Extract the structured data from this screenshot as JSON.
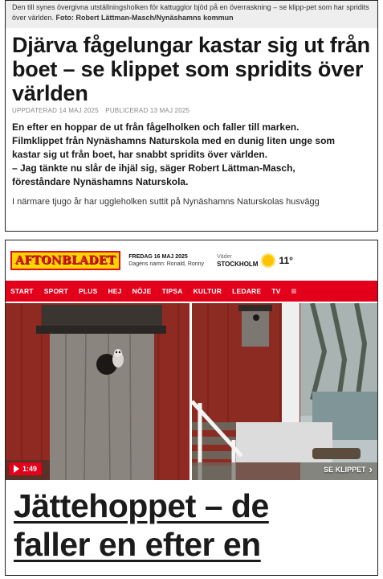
{
  "article_top": {
    "caption": "Den till synes övergivna utställningsholken för kattugglor bjöd på en överraskning – se klipp-pet som har spridits över världen.",
    "caption_credit": "Foto: Robert Lättman-Masch/Nynäshamns kommun",
    "headline": "Djärva fågelungar kastar sig ut från boet – se klippet som spridits över världen",
    "updated": "UPPDATERAD 14 MAJ 2025",
    "published": "PUBLICERAD 13 MAJ 2025",
    "lead_lines": [
      "En efter en hoppar de ut från fågelholken och faller till marken.",
      "Filmklippet från Nynäshamns Naturskola med en dunig liten unge som",
      "kastar sig ut från boet, har snabbt spridits över världen.",
      "– Jag tänkte nu slår de ihjäl sig, säger Robert Lättman-Masch,",
      "föreståndare Nynäshamns Naturskola."
    ],
    "body_partial": "I närmare tjugo år har uggleholken suttit på Nynäshamns Naturskolas husvägg"
  },
  "aftonbladet": {
    "logo": "AFTONBLADET",
    "date_line1": "FREDAG 16 MAJ 2025",
    "date_line2": "Dagens namn: Ronald, Ronny",
    "weather_label": "Väder",
    "weather_city": "STOCKHOLM",
    "weather_temp": "11°",
    "weather_icon": "sun-icon",
    "nav": [
      "START",
      "SPORT",
      "PLUS",
      "HEJ",
      "NÖJE",
      "TIPSA",
      "KULTUR",
      "LEDARE",
      "TV"
    ],
    "nav_menu_icon": "≡",
    "video_duration": "1:49",
    "see_clip": "SE KLIPPET",
    "headline_line1": "Jättehoppet – de",
    "headline_line2": "faller en efter en"
  },
  "colors": {
    "accent_red": "#e3001b",
    "logo_yellow": "#ffd400",
    "caption_bg": "#eeeeee"
  }
}
